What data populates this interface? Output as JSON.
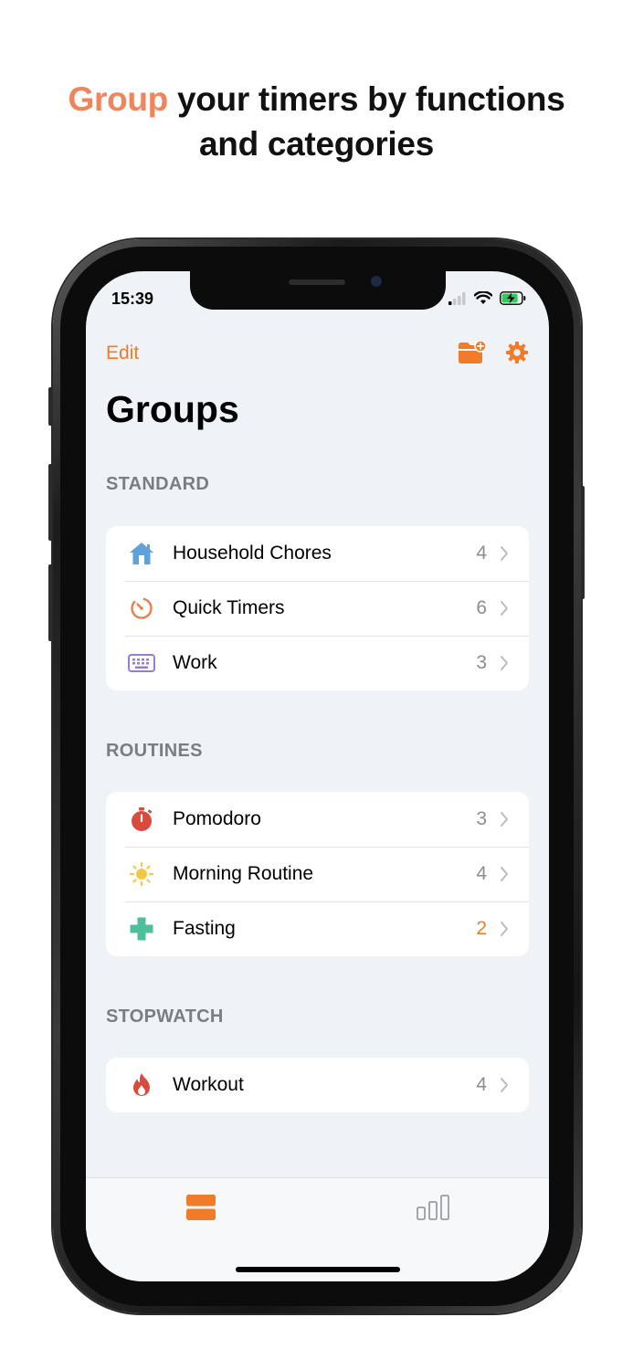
{
  "headline": {
    "accent": "Group",
    "rest_line1": " your timers by functions",
    "line2": "and categories"
  },
  "status_bar": {
    "time": "15:39"
  },
  "nav": {
    "edit_label": "Edit",
    "title": "Groups"
  },
  "sections": [
    {
      "label": "STANDARD",
      "items": [
        {
          "label": "Household Chores",
          "count": "4",
          "icon": "house-icon"
        },
        {
          "label": "Quick Timers",
          "count": "6",
          "icon": "timer-icon"
        },
        {
          "label": "Work",
          "count": "3",
          "icon": "keyboard-icon"
        }
      ]
    },
    {
      "label": "ROUTINES",
      "items": [
        {
          "label": "Pomodoro",
          "count": "3",
          "icon": "stopwatch-icon"
        },
        {
          "label": "Morning Routine",
          "count": "4",
          "icon": "sun-icon"
        },
        {
          "label": "Fasting",
          "count": "2",
          "icon": "plus-cross-icon",
          "count_color": "#f07c2a"
        }
      ]
    },
    {
      "label": "STOPWATCH",
      "items": [
        {
          "label": "Workout",
          "count": "4",
          "icon": "flame-icon"
        }
      ]
    }
  ],
  "tab_bar": {
    "tabs": [
      {
        "icon": "groups-tab-icon",
        "active": true
      },
      {
        "icon": "stats-tab-icon",
        "active": false
      }
    ]
  },
  "colors": {
    "accent": "#f07c2a",
    "headline_accent": "#f0845a",
    "background": "#eff2f6"
  }
}
